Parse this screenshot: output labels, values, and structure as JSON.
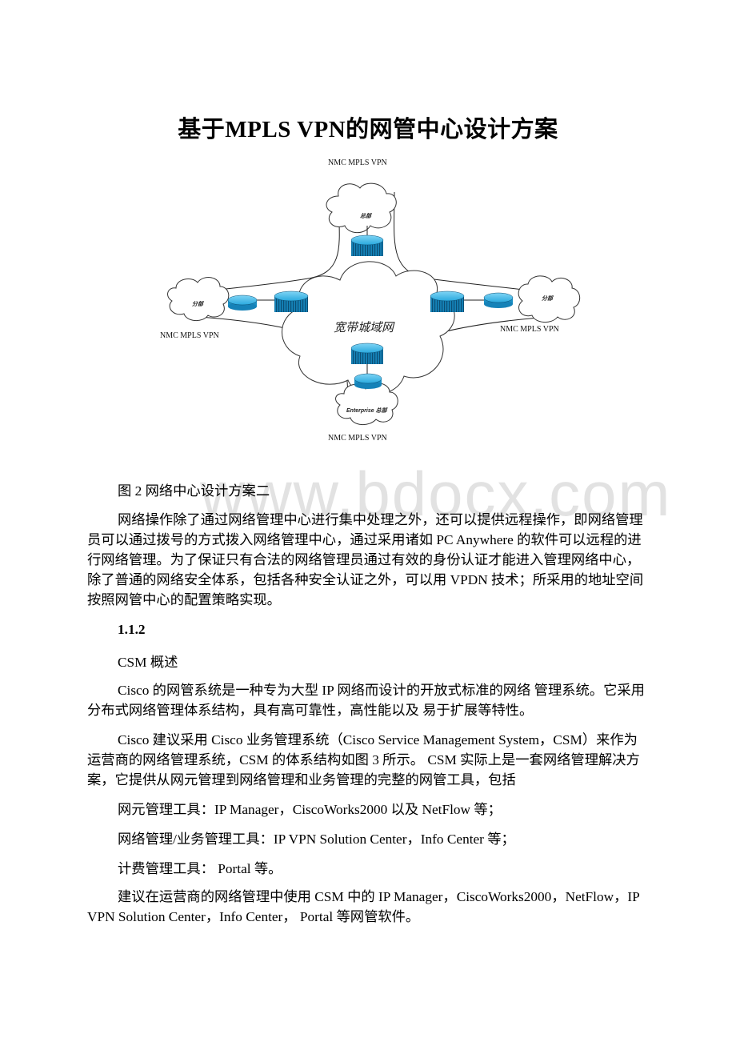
{
  "document": {
    "title": "基于MPLS VPN的网管中心设计方案",
    "watermark": "www.bdocx.com"
  },
  "diagram": {
    "top_label": "NMC MPLS VPN",
    "left_label": "NMC MPLS VPN",
    "right_label": "NMC MPLS VPN",
    "bottom_label": "NMC MPLS VPN",
    "core_label": "宽带城域网",
    "cloud_top_text": "总部",
    "cloud_left_text": "分部",
    "cloud_right_text": "分部",
    "cloud_bottom_text": "Enterprise 总部",
    "router_color": "#1a9fd4"
  },
  "body": {
    "figure_caption": "图 2 网络中心设计方案二",
    "para1": "网络操作除了通过网络管理中心进行集中处理之外，还可以提供远程操作，即网络管理员可以通过拨号的方式拨入网络管理中心，通过采用诸如 PC Anywhere 的软件可以远程的进行网络管理。为了保证只有合法的网络管理员通过有效的身份认证才能进入管理网络中心，除了普通的网络安全体系，包括各种安全认证之外，可以用 VPDN 技术；所采用的地址空间按照网管中心的配置策略实现。",
    "section_number": "1.1.2",
    "section_title": "CSM 概述",
    "para2": "Cisco 的网管系统是一种专为大型 IP 网络而设计的开放式标准的网络 管理系统。它采用分布式网络管理体系结构，具有高可靠性，高性能以及 易于扩展等特性。",
    "para3": "Cisco 建议采用 Cisco 业务管理系统（Cisco Service Management System，CSM）来作为运营商的网络管理系统，CSM 的体系结构如图 3 所示。 CSM 实际上是一套网络管理解决方案，它提供从网元管理到网络管理和业务管理的完整的网管工具，包括",
    "list_item1": "网元管理工具：IP Manager，CiscoWorks2000 以及 NetFlow 等；",
    "list_item2": "网络管理/业务管理工具：IP VPN Solution Center，Info Center 等；",
    "list_item3": "计费管理工具： Portal 等。",
    "para4": "建议在运营商的网络管理中使用 CSM 中的 IP Manager，CiscoWorks2000，NetFlow，IP VPN Solution Center，Info Center， Portal 等网管软件。"
  }
}
